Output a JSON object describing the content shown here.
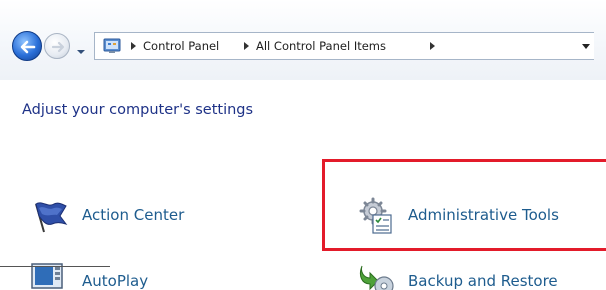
{
  "address_bar": {
    "breadcrumbs": [
      "Control Panel",
      "All Control Panel Items"
    ],
    "icons": {
      "back": "back-arrow-icon",
      "forward": "forward-arrow-icon",
      "recent": "chevron-down-icon",
      "location": "control-panel-icon",
      "dropdown": "chevron-down-icon"
    }
  },
  "main": {
    "heading": "Adjust your computer's settings",
    "items": [
      {
        "label": "Action Center",
        "icon": "flag-icon"
      },
      {
        "label": "Administrative Tools",
        "icon": "admin-tools-icon",
        "highlighted": true
      },
      {
        "label": "AutoPlay",
        "icon": "autoplay-icon"
      },
      {
        "label": "Backup and Restore",
        "icon": "backup-icon"
      }
    ]
  },
  "colors": {
    "link": "#1e5c8e",
    "heading": "#1e3287",
    "highlight": "#e31b2a"
  }
}
